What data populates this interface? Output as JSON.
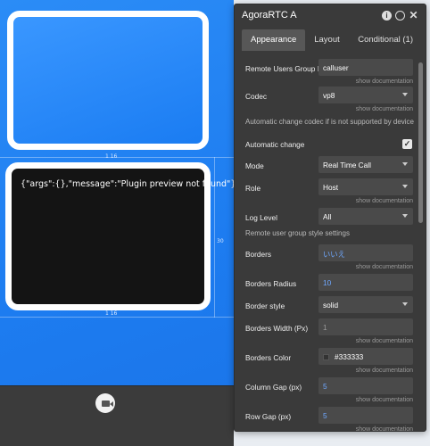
{
  "canvas": {
    "plugin_message": "{\"args\":{},\"message\":\"Plugin preview not found\"}",
    "dim_top": "1 16",
    "dim_right": "30",
    "dim_bottom": "1 16"
  },
  "panel": {
    "title": "AgoraRTC A",
    "tabs": [
      "Appearance",
      "Layout",
      "Conditional (1)"
    ],
    "show_doc": "show documentation",
    "fields": {
      "remote_users_group": {
        "label": "Remote Users Group I",
        "value": "calluser"
      },
      "codec": {
        "label": "Codec",
        "value": "vp8"
      },
      "codec_note": "Automatic change codec if is not supported by device",
      "automatic_change": {
        "label": "Automatic change",
        "checked": true
      },
      "mode": {
        "label": "Mode",
        "value": "Real Time Call"
      },
      "role": {
        "label": "Role",
        "value": "Host"
      },
      "log_level": {
        "label": "Log Level",
        "value": "All"
      },
      "style_note": "Remote user group style settings",
      "borders": {
        "label": "Borders",
        "value": "いいえ"
      },
      "borders_radius": {
        "label": "Borders Radius",
        "value": "10"
      },
      "border_style": {
        "label": "Border style",
        "value": "solid"
      },
      "borders_width": {
        "label": "Borders Width (Px)",
        "value": "1"
      },
      "borders_color": {
        "label": "Borders Color",
        "value": "#333333"
      },
      "column_gap": {
        "label": "Column Gap (px)",
        "value": "5"
      },
      "row_gap": {
        "label": "Row Gap (px)",
        "value": "5"
      }
    }
  },
  "colors": {
    "accent_blue": "#1d7cf0",
    "panel_bg": "#3a3a3a",
    "field_bg": "#4a4a4a",
    "link_value": "#6fa8ff"
  }
}
